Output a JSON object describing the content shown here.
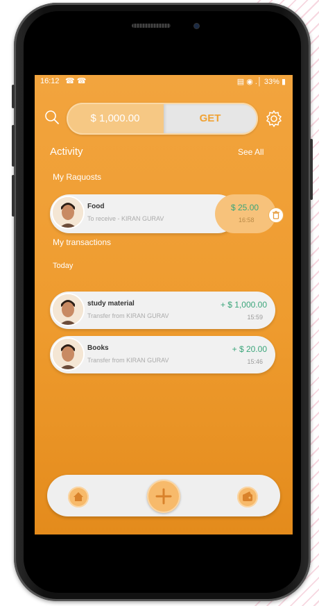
{
  "status_bar": {
    "time": "16:12",
    "call_icons": "☎ ☎",
    "right_text": "▤ ◉ .│ 33% ▮"
  },
  "header": {
    "balance": "$ 1,000.00",
    "get_label": "GET"
  },
  "activity": {
    "title": "Activity",
    "see_all": "See All"
  },
  "requests": {
    "section_label": "My Raquosts",
    "items": [
      {
        "title": "Food",
        "subtitle": "To receive - KIRAN GURAV",
        "amount": "$ 25.00",
        "time": "16:58"
      }
    ]
  },
  "transactions": {
    "section_label": "My transactions",
    "day_label": "Today",
    "items": [
      {
        "title": "study material",
        "subtitle": "Transfer from KIRAN GURAV",
        "amount": "+ $ 1,000.00",
        "time": "15:59"
      },
      {
        "title": "Books",
        "subtitle": "Transfer from KIRAN GURAV",
        "amount": "+ $ 20.00",
        "time": "15:46"
      }
    ]
  },
  "bottom_nav": {
    "home_icon": "home-icon",
    "add_icon": "add-icon",
    "wallet_icon": "wallet-icon"
  },
  "colors": {
    "accent": "#f0a234",
    "positive_amount": "#3aa57a",
    "card_bg": "#f1f1f1"
  }
}
